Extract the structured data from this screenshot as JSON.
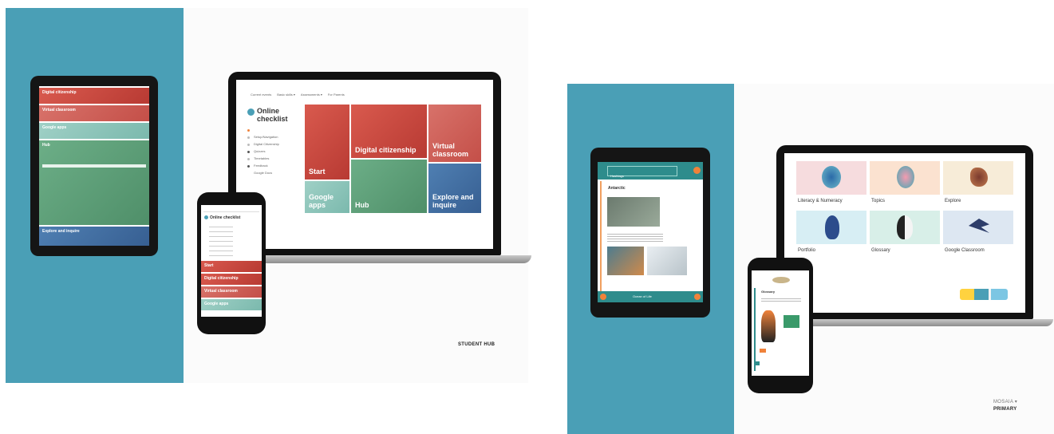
{
  "left_mockup": {
    "caption": "STUDENT HUB",
    "laptop": {
      "nav": [
        "Current events",
        "Basic skills ▾",
        "Assessments ▾",
        "For Parents"
      ],
      "title": "Online checklist",
      "menu": [
        "Setup/Navigation",
        "Digital Citizenship",
        "Quizzes",
        "Timetables",
        "Feedback",
        "Google Docs"
      ],
      "tiles": {
        "start": "Start",
        "digital_citizenship": "Digital citizenship",
        "virtual_classroom": "Virtual classroom",
        "google_apps": "Google apps",
        "hub": "Hub",
        "explore_inquire": "Explore and inquire"
      }
    },
    "tablet": {
      "rows": [
        "Digital citizenship",
        "Virtual classroom",
        "Google apps",
        "Hub",
        "Explore and inquire"
      ]
    },
    "phone": {
      "title": "Online checklist",
      "rows": [
        "Start",
        "Digital citizenship",
        "Virtual classroom",
        "Google apps"
      ]
    }
  },
  "right_mockup": {
    "caption_top": "MOSAIA ▾",
    "caption_bottom": "PRIMARY",
    "laptop": {
      "cards": [
        "Literacy & Numeracy",
        "Topics",
        "Explore",
        "Portfolio",
        "Glossary",
        "Google Classroom"
      ]
    },
    "tablet": {
      "search": "Hashtags",
      "heading": "Antarctic",
      "footer": "Ocean of Life"
    },
    "phone": {
      "heading": "Glossary"
    }
  },
  "colors": {
    "teal_panel": "#4a9fb6",
    "red": "#c6463d",
    "green": "#5f9e78",
    "mint": "#8cc5b9",
    "blue": "#4670a2",
    "orange": "#f0823a"
  }
}
